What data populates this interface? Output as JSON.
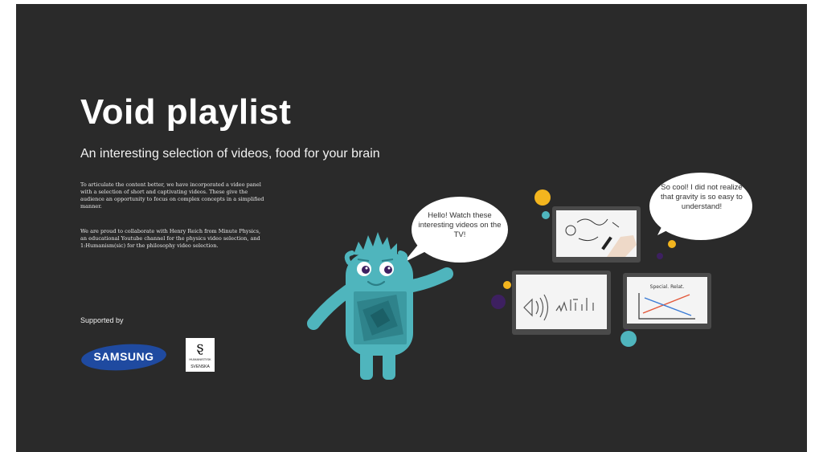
{
  "page": {
    "title": "Void playlist",
    "subtitle": "An interesting selection of videos, food for your brain",
    "paragraphs": [
      "To articulate the content better, we have incorporated a video panel with a selection of short and captivating videos. These give the audience an opportunity to focus on complex concepts in a simplified manner.",
      "We are proud to collaborate with Henry Reich from Minute Physics, an educational Youtube channel for the physics video selection, and 1:Humanism(sic) for the philosophy video selection."
    ]
  },
  "sponsors": {
    "label": "Supported by",
    "samsung": "SAMSUNG",
    "partner_small": "HUMANISTISK",
    "partner_brand": "SVENSKA"
  },
  "bubbles": {
    "mascot": "Hello! Watch these interesting videos on the TV!",
    "viewer": "So cool! I did not realize that gravity is so easy to understand!"
  },
  "videos": {
    "graph_label": "Special. Relat."
  },
  "colors": {
    "background": "#2a2a2a",
    "mascot_teal": "#4fb5bd",
    "accent_yellow": "#f3b51e",
    "accent_purple": "#3d2060",
    "samsung_blue": "#1f4aa0"
  }
}
